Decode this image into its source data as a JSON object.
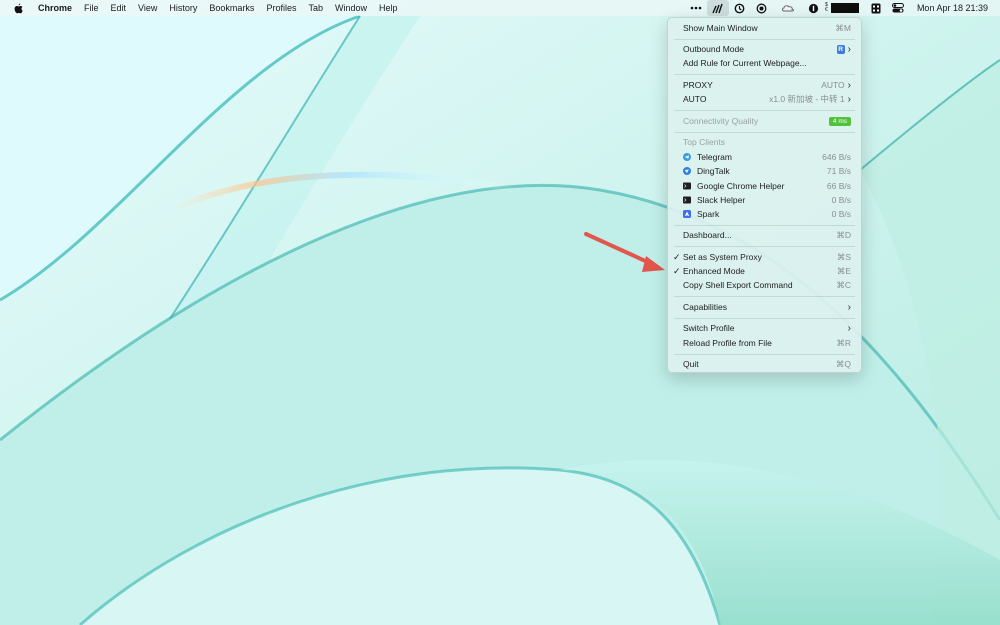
{
  "menubar": {
    "app_name": "Chrome",
    "menus": [
      "File",
      "Edit",
      "View",
      "History",
      "Bookmarks",
      "Profiles",
      "Tab",
      "Window",
      "Help"
    ],
    "clock": "Mon Apr 18  21:39",
    "icons": [
      "apple-icon",
      "more-icon",
      "surge-icon",
      "timer-icon",
      "record-icon",
      "cloud-icon",
      "onepassword-icon",
      "battery-icon",
      "calculator-icon",
      "control-center-icon"
    ]
  },
  "menu": {
    "show_main_window": "Show Main Window",
    "show_main_window_shortcut": "⌘M",
    "outbound_mode": "Outbound Mode",
    "outbound_badge": "R",
    "add_rule": "Add Rule for Current Webpage...",
    "proxy_label": "PROXY",
    "proxy_value": "AUTO",
    "auto_label": "AUTO",
    "auto_value": "x1.0 新加坡 - 中转 1",
    "connectivity_label": "Connectivity Quality",
    "connectivity_value": "4 ms",
    "top_clients_header": "Top Clients",
    "clients": [
      {
        "name": "Telegram",
        "speed": "646 B/s",
        "icon": "telegram-icon"
      },
      {
        "name": "DingTalk",
        "speed": "71 B/s",
        "icon": "dingtalk-icon"
      },
      {
        "name": "Google Chrome Helper",
        "speed": "66 B/s",
        "icon": "terminal-icon"
      },
      {
        "name": "Slack Helper",
        "speed": "0 B/s",
        "icon": "terminal-icon"
      },
      {
        "name": "Spark",
        "speed": "0 B/s",
        "icon": "spark-icon"
      }
    ],
    "dashboard": "Dashboard...",
    "dashboard_shortcut": "⌘D",
    "set_system_proxy": "Set as System Proxy",
    "set_system_proxy_shortcut": "⌘S",
    "enhanced_mode": "Enhanced Mode",
    "enhanced_mode_shortcut": "⌘E",
    "copy_shell": "Copy Shell Export Command",
    "copy_shell_shortcut": "⌘C",
    "capabilities": "Capabilities",
    "switch_profile": "Switch Profile",
    "reload_profile": "Reload Profile from File",
    "reload_profile_shortcut": "⌘R",
    "quit": "Quit",
    "quit_shortcut": "⌘Q",
    "checkmark": "✓",
    "chevron": "›"
  },
  "colors": {
    "accent_blue": "#3f7be6",
    "latency_green": "#52c23c",
    "arrow_red": "#e2574c"
  }
}
